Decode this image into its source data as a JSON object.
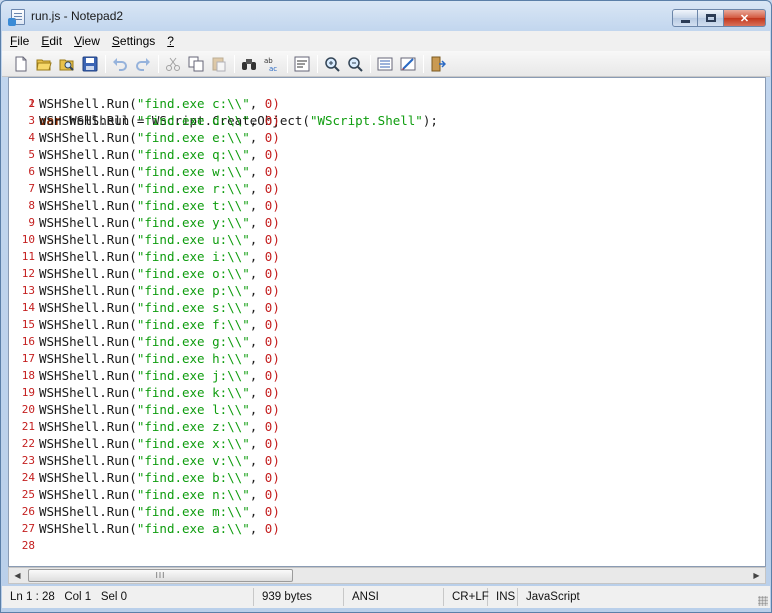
{
  "window": {
    "title": "run.js - Notepad2"
  },
  "menu": [
    {
      "label": "File",
      "ul": "F",
      "rest": "ile"
    },
    {
      "label": "Edit",
      "ul": "E",
      "rest": "dit"
    },
    {
      "label": "View",
      "ul": "V",
      "rest": "iew"
    },
    {
      "label": "Settings",
      "ul": "S",
      "rest": "ettings"
    },
    {
      "label": "?",
      "ul": "?",
      "rest": ""
    }
  ],
  "editor": {
    "first_line": {
      "keyword": "var",
      "text": " WSHShell = WScript.CreateObject(",
      "string": "\"WScript.Shell\"",
      "tail": ");"
    },
    "run_lines": [
      {
        "drive": "c"
      },
      {
        "drive": "d"
      },
      {
        "drive": "e"
      },
      {
        "drive": "q"
      },
      {
        "drive": "w"
      },
      {
        "drive": "r"
      },
      {
        "drive": "t"
      },
      {
        "drive": "y"
      },
      {
        "drive": "u"
      },
      {
        "drive": "i"
      },
      {
        "drive": "o"
      },
      {
        "drive": "p"
      },
      {
        "drive": "s"
      },
      {
        "drive": "f"
      },
      {
        "drive": "g"
      },
      {
        "drive": "h"
      },
      {
        "drive": "j"
      },
      {
        "drive": "k"
      },
      {
        "drive": "l"
      },
      {
        "drive": "z"
      },
      {
        "drive": "x"
      },
      {
        "drive": "v"
      },
      {
        "drive": "b"
      },
      {
        "drive": "n"
      },
      {
        "drive": "m"
      },
      {
        "drive": "a"
      }
    ],
    "run_prefix": "WSHShell.Run(",
    "run_string_prefix": "\"find.exe ",
    "run_string_suffix": ":\\\\\"",
    "run_tail_comma": ", ",
    "run_tail_num": "0",
    "run_tail_close": ")",
    "last_line_number": "28"
  },
  "status": {
    "position": "Ln 1 : 28",
    "col": "Col 1",
    "sel": "Sel 0",
    "size": "939 bytes",
    "encoding": "ANSI",
    "eol": "CR+LF",
    "mode": "INS",
    "lexer": "JavaScript"
  },
  "scrollbar": {
    "thumb_grip": "III"
  }
}
